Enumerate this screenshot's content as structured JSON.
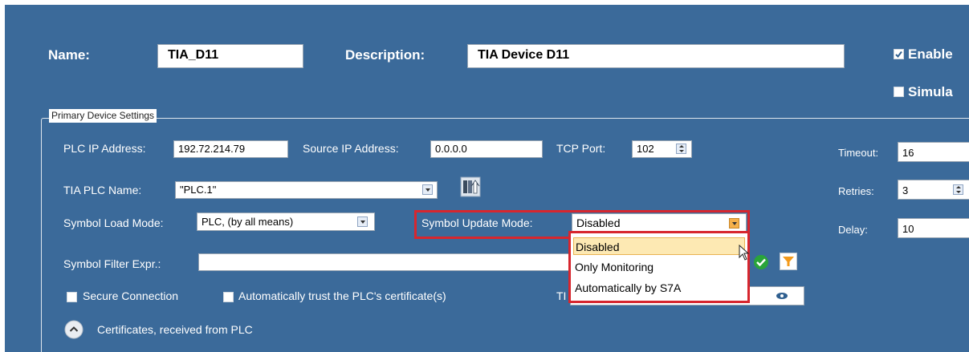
{
  "header": {
    "name_label": "Name:",
    "name_value": "TIA_D11",
    "description_label": "Description:",
    "description_value": "TIA Device D11",
    "enable_label": "Enable",
    "simulate_label": "Simula"
  },
  "primary": {
    "group_title": "Primary Device Settings",
    "plc_ip_label": "PLC IP Address:",
    "plc_ip_value": "192.72.214.79",
    "source_ip_label": "Source IP Address:",
    "source_ip_value": "0.0.0.0",
    "tcp_port_label": "TCP Port:",
    "tcp_port_value": "102",
    "tia_plc_name_label": "TIA PLC Name:",
    "tia_plc_name_value": "\"PLC.1\"",
    "symbol_load_label": "Symbol Load Mode:",
    "symbol_load_value": "PLC, (by all means)",
    "symbol_update_label": "Symbol Update Mode:",
    "symbol_update_value": "Disabled",
    "symbol_update_options": [
      "Disabled",
      "Only Monitoring",
      "Automatically by S7A"
    ],
    "symbol_filter_label": "Symbol Filter Expr.:",
    "symbol_filter_value": "",
    "secure_connection_label": "Secure Connection",
    "trust_cert_label": "Automatically trust the PLC's certificate(s)",
    "ti_label_partial": "TI",
    "certificates_label": "Certificates, received from PLC"
  },
  "timing": {
    "timeout_label": "Timeout:",
    "timeout_value": "16",
    "retries_label": "Retries:",
    "retries_value": "3",
    "delay_label": "Delay:",
    "delay_value": "10"
  },
  "colors": {
    "panel_bg": "#3b6a9a",
    "highlight_red": "#d7262e",
    "selected_item_bg": "#fde9b3",
    "accent_green": "#2aa43a",
    "accent_orange": "#f39a1b"
  },
  "icons": [
    "checkbox-checked-icon",
    "checkbox-unchecked-icon",
    "dropdown-arrow-icon",
    "spinner-icon",
    "browse-plc-icon",
    "apply-check-icon",
    "filter-icon",
    "eye-icon",
    "collapse-chevron-icon",
    "mouse-cursor-icon"
  ]
}
